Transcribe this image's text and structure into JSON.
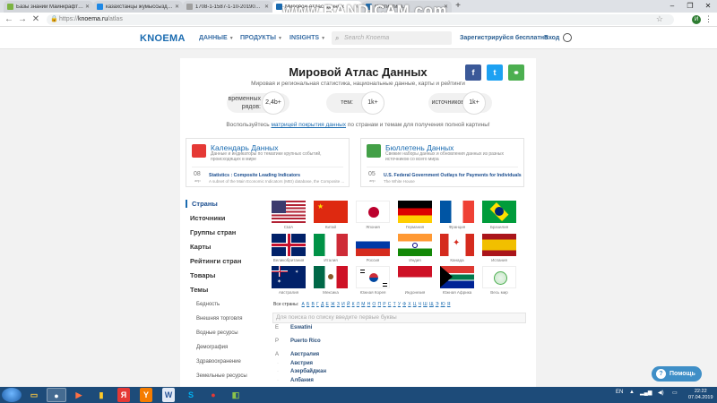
{
  "browser": {
    "tabs": [
      {
        "title": "Базы знаний Майнкрафт - ..."
      },
      {
        "title": "казахстанцы жумыссыздык..."
      },
      {
        "title": "1708-1-1587-1-10-20190131 (1..."
      },
      {
        "title": "Мировой Атлас Данных"
      },
      {
        "title": "Статистика..."
      }
    ],
    "new_tab": "+",
    "url_domain": "knoema.ru",
    "url_path": "/atlas",
    "url_prefix": "https://",
    "profile_initial": "И"
  },
  "watermark": "www.BANDICAM.com",
  "site": {
    "logo": "KNOEMA",
    "nav": [
      "ДАННЫЕ",
      "ПРОДУКТЫ",
      "INSIGHTS"
    ],
    "search_placeholder": "Search Knoema",
    "register": "Зарегистрируйся бесплатно",
    "login": "Вход"
  },
  "atlas": {
    "title": "Мировой Атлас Данных",
    "subtitle": "Мировая и региональная статистика, национальные данные, карты и рейтинги",
    "stats": [
      {
        "label_1": "временных",
        "label_2": "рядов:",
        "value": "2,4b+"
      },
      {
        "label_1": "тем:",
        "label_2": "",
        "value": "1k+"
      },
      {
        "label_1": "источников:",
        "label_2": "",
        "value": "1k+"
      }
    ],
    "help_prefix": "Воспользуйтесь ",
    "help_link": "матрицей покрытия данных",
    "help_suffix": " по странам и темам для получения полной картины!",
    "share": {
      "facebook": "f",
      "twitter": "t",
      "link": "⚭"
    }
  },
  "cards": {
    "calendar": {
      "title": "Календарь Данных",
      "desc": "Данные и индикаторы по тематике крупных событий, происходящих в мире",
      "day": "08",
      "month": "апр",
      "link": "Statistics : Composite Leading Indicators",
      "sub": "A subset of the Main Economic Indicators (MEI) database, the Composite ..."
    },
    "bulletin": {
      "title": "Бюллетень Данных",
      "desc": "Свежие наборы данных и обновления данных из разных источников со всего мира",
      "day": "05",
      "month": "апр",
      "link": "U.S. Federal Government Outlays for Payments for Individuals",
      "sub": "The White House"
    }
  },
  "side_menu": {
    "items": [
      "Страны",
      "Источники",
      "Группы стран",
      "Карты",
      "Рейтинги стран",
      "Товары",
      "Темы"
    ],
    "sub_items": [
      "Бедность",
      "Внешняя торговля",
      "Водные ресурсы",
      "Демография",
      "Здравоохранение",
      "Земельные ресурсы"
    ]
  },
  "flags": [
    {
      "name": "США",
      "code": "us"
    },
    {
      "name": "Китай",
      "code": "cn"
    },
    {
      "name": "Япония",
      "code": "jp"
    },
    {
      "name": "Германия",
      "code": "de"
    },
    {
      "name": "Франция",
      "code": "fr"
    },
    {
      "name": "Бразилия",
      "code": "br"
    },
    {
      "name": "Великобритания",
      "code": "gb"
    },
    {
      "name": "Италия",
      "code": "it"
    },
    {
      "name": "Россия",
      "code": "ru"
    },
    {
      "name": "Индия",
      "code": "in"
    },
    {
      "name": "Канада",
      "code": "ca"
    },
    {
      "name": "Испания",
      "code": "es"
    },
    {
      "name": "Австралия",
      "code": "au"
    },
    {
      "name": "Мексика",
      "code": "mx"
    },
    {
      "name": "Южная Корея",
      "code": "kr"
    },
    {
      "name": "Индонезия",
      "code": "id"
    },
    {
      "name": "Южная Африка",
      "code": "za"
    },
    {
      "name": "Весь мир",
      "code": "world"
    }
  ],
  "alphabet": {
    "label": "Все страны:",
    "letters": [
      "А",
      "Б",
      "В",
      "Г",
      "Д",
      "Е",
      "Ж",
      "З",
      "И",
      "Й",
      "К",
      "Л",
      "М",
      "Н",
      "О",
      "П",
      "Р",
      "С",
      "Т",
      "У",
      "Ф",
      "Х",
      "Ц",
      "Ч",
      "Ш",
      "Щ",
      "Э",
      "Ю",
      "Я"
    ]
  },
  "filter_placeholder": "Для поиска по списку введите первые буквы",
  "country_list": [
    {
      "letter": "E",
      "countries": [
        "Eswatini"
      ]
    },
    {
      "letter": "P",
      "countries": [
        "Puerto Rico"
      ]
    },
    {
      "letter": "А",
      "countries": [
        "Австралия",
        "Австрия",
        "Азербайджан",
        "Албания"
      ]
    }
  ],
  "help_button": "Помощь",
  "taskbar": {
    "apps": [
      {
        "name": "explorer-app",
        "glyph": "▭"
      },
      {
        "name": "chrome-app",
        "glyph": "●"
      },
      {
        "name": "media-app",
        "glyph": "▶"
      },
      {
        "name": "files-app",
        "glyph": "▮"
      },
      {
        "name": "yandex-app",
        "glyph": "Я"
      },
      {
        "name": "yandex-browser-app",
        "glyph": "Y"
      },
      {
        "name": "word-app",
        "glyph": "W"
      },
      {
        "name": "skype-app",
        "glyph": "S"
      },
      {
        "name": "bandicam-app",
        "glyph": "●"
      },
      {
        "name": "viewer-app",
        "glyph": "◧"
      }
    ],
    "lang": "EN",
    "time": "22:22",
    "date": "07.04.2019"
  }
}
